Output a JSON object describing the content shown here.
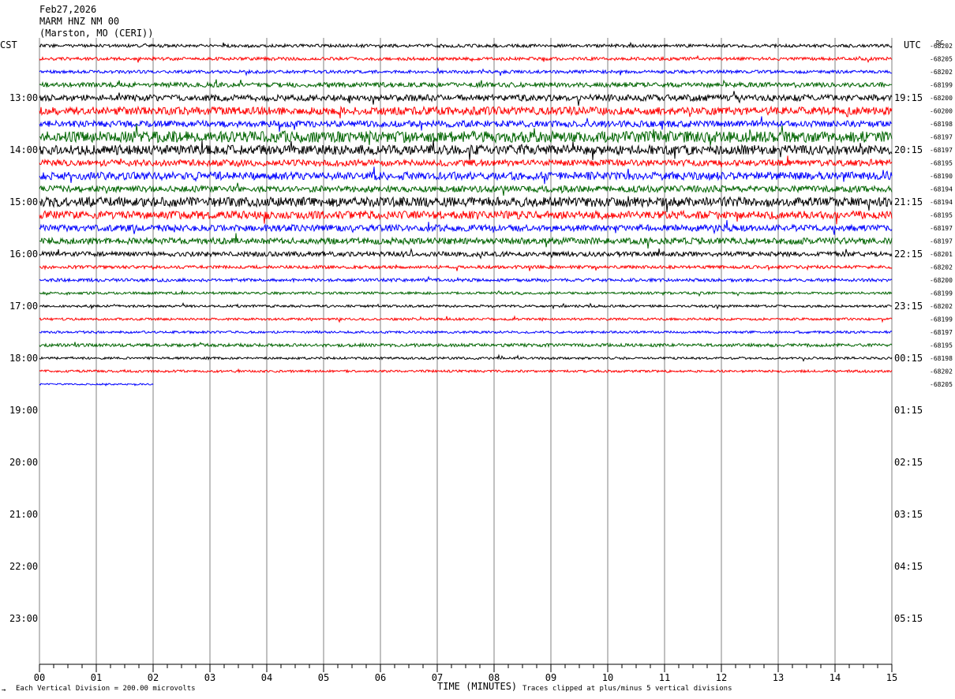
{
  "header": {
    "date": "Feb27,2026",
    "station": "MARM HNZ NM 00",
    "location": "(Marston, MO (CERI))"
  },
  "left_zone": "CST",
  "right_zone": "UTC",
  "dc_label": "DC",
  "footer": {
    "scale_note": "Each Vertical Division =  200.00 microvolts",
    "xlabel": "TIME (MINUTES)",
    "clip_note": "Traces clipped at plus/minus 5 vertical divisions",
    "corner_mark": "→"
  },
  "colors": {
    "c0": "#000000",
    "c1": "#ff0000",
    "c2": "#0000ff",
    "c3": "#006400",
    "grid": "#808080"
  },
  "chart_data": {
    "type": "line",
    "title": "MARM HNZ NM 00",
    "xlabel": "TIME (MINUTES)",
    "x_ticks": [
      "00",
      "01",
      "02",
      "03",
      "04",
      "05",
      "06",
      "07",
      "08",
      "09",
      "10",
      "11",
      "12",
      "13",
      "14",
      "15"
    ],
    "xlim": [
      0,
      15
    ],
    "trace_interval_minutes": 15,
    "hour_rows": [
      {
        "local": "13:00",
        "utc": "19:15"
      },
      {
        "local": "14:00",
        "utc": "20:15"
      },
      {
        "local": "15:00",
        "utc": "21:15"
      },
      {
        "local": "16:00",
        "utc": "22:15"
      },
      {
        "local": "17:00",
        "utc": "23:15"
      },
      {
        "local": "18:00",
        "utc": "00:15"
      },
      {
        "local": "19:00",
        "utc": "01:15"
      },
      {
        "local": "20:00",
        "utc": "02:15"
      },
      {
        "local": "21:00",
        "utc": "03:15"
      },
      {
        "local": "22:00",
        "utc": "04:15"
      },
      {
        "local": "23:00",
        "utc": "05:15"
      }
    ],
    "dc_offsets": [
      -68202,
      -68205,
      -68202,
      -68199,
      -68200,
      -60200,
      -68198,
      -68197,
      -68197,
      -68195,
      -68190,
      -68194,
      -68194,
      -68195,
      -68197,
      -68197,
      -68201,
      -68202,
      -68200,
      -68199,
      -68202,
      -68199,
      -68197,
      -68195,
      -68198,
      -68202,
      -68205
    ],
    "trace_amplitudes": [
      2,
      2,
      2,
      3,
      4,
      5,
      4,
      7,
      6,
      4,
      5,
      4,
      6,
      5,
      4,
      4,
      3,
      2,
      2,
      1.5,
      1.5,
      1.5,
      1.5,
      2,
      1.5,
      1.5,
      1
    ],
    "trace_end_minutes": [
      15,
      15,
      15,
      15,
      15,
      15,
      15,
      15,
      15,
      15,
      15,
      15,
      15,
      15,
      15,
      15,
      15,
      15,
      15,
      15,
      15,
      15,
      15,
      15,
      15,
      15,
      2
    ],
    "clip_divisions": 5,
    "microvolts_per_division": 200.0
  }
}
